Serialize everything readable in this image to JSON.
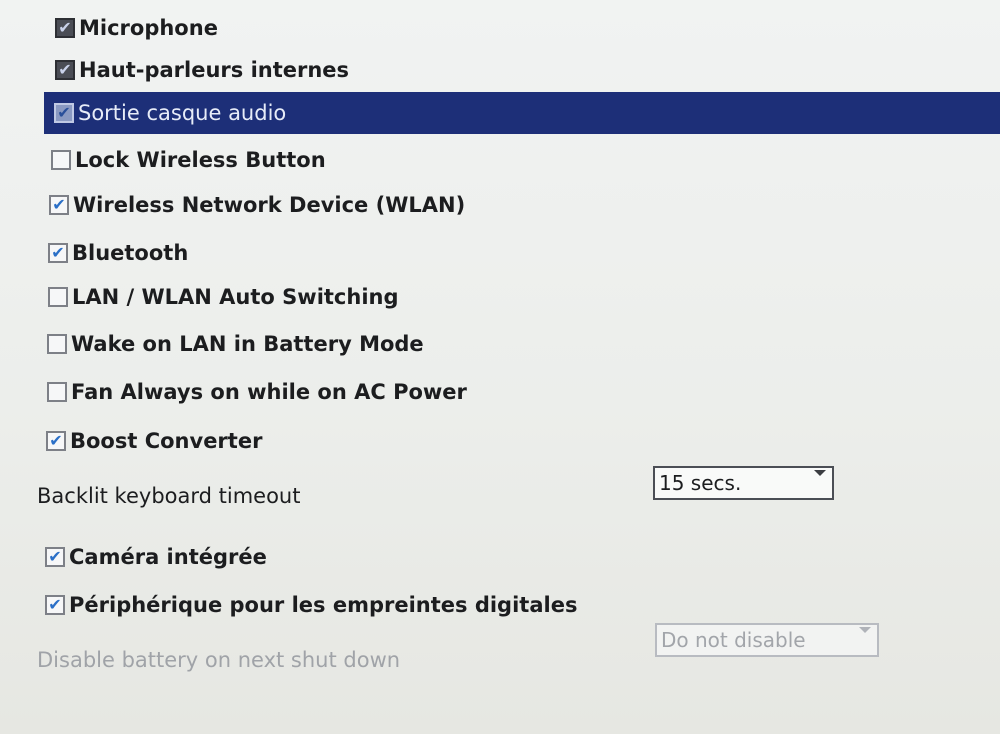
{
  "settings": {
    "items": [
      {
        "label": "Microphone",
        "checked": true
      },
      {
        "label": "Haut-parleurs internes",
        "checked": true
      },
      {
        "label": "Sortie casque audio",
        "checked": true,
        "selected": true
      },
      {
        "label": "Lock Wireless Button",
        "checked": false
      },
      {
        "label": "Wireless Network Device (WLAN)",
        "checked": true
      },
      {
        "label": "Bluetooth",
        "checked": true
      },
      {
        "label": "LAN / WLAN Auto Switching",
        "checked": false
      },
      {
        "label": "Wake on LAN in Battery Mode",
        "checked": false
      },
      {
        "label": "Fan Always on while on AC Power",
        "checked": false
      },
      {
        "label": "Boost Converter",
        "checked": true
      },
      {
        "label": "Caméra intégrée",
        "checked": true
      },
      {
        "label": "Périphérique pour les empreintes digitales",
        "checked": true
      }
    ],
    "backlit": {
      "label": "Backlit keyboard timeout",
      "value": "15 secs."
    },
    "battery": {
      "label": "Disable battery on next shut down",
      "value": "Do not disable",
      "disabled": true
    }
  },
  "colors": {
    "selection": "#1d2f78",
    "check": "#2a6fc7",
    "disabled_text": "#a0a3a8"
  },
  "icons": {
    "checkbox_checked": "check-mark-icon",
    "dropdown": "chevron-down-icon"
  }
}
